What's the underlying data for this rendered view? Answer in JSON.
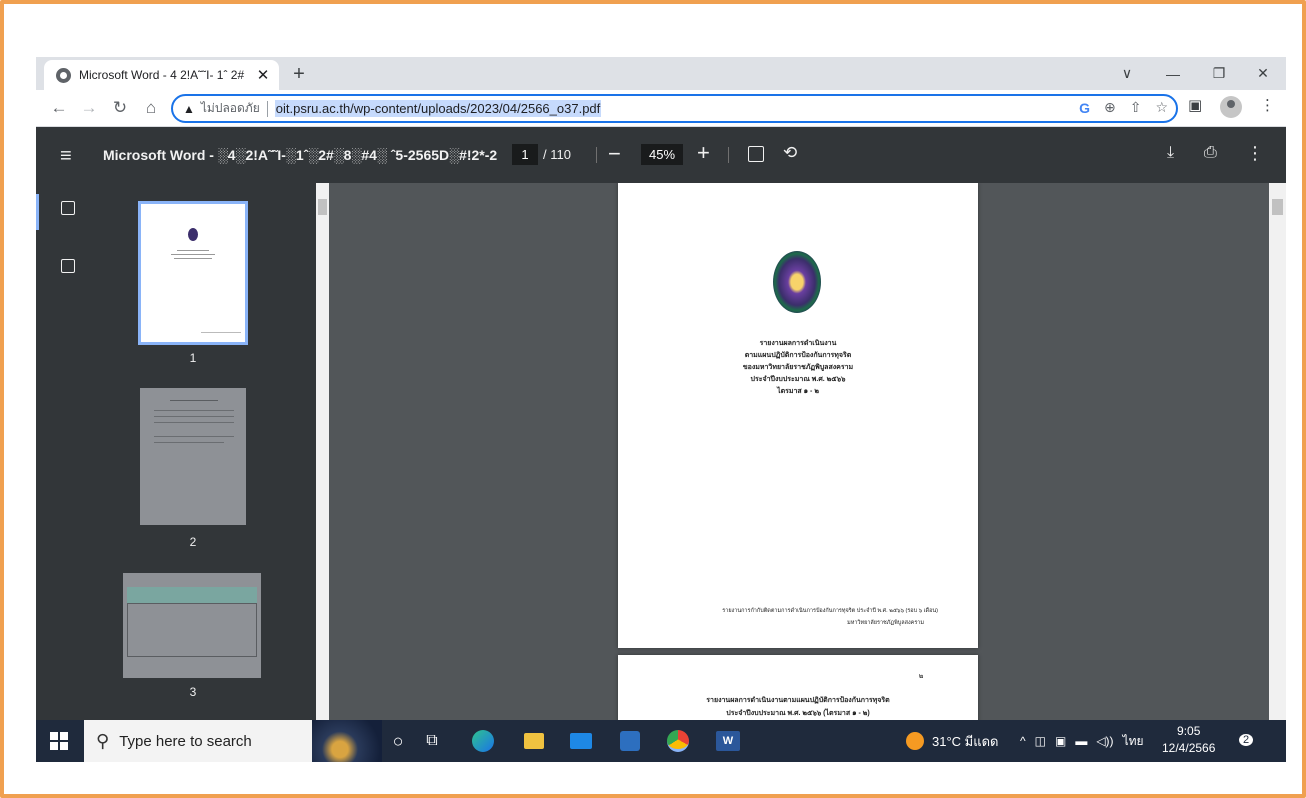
{
  "browser": {
    "tab_title": "Microsoft Word - 4 2!A˜˜I- 1ˆ 2#",
    "tab_close": "✕",
    "new_tab": "+",
    "not_secure_label": "ไม่ปลอดภัย",
    "url": "oit.psru.ac.th/wp-content/uploads/2023/04/2566_o37.pdf",
    "google_icon": "G"
  },
  "pdf": {
    "title": "Microsoft Word - ░4░2!A˜˜I-░1ˆ░2#░8░#4░ ˆ5-2565D░#!2*-2",
    "current_page": "1",
    "total_pages": "/ 110",
    "zoom": "45%",
    "thumbnails": [
      {
        "label": "1"
      },
      {
        "label": "2"
      },
      {
        "label": "3"
      }
    ],
    "page1": {
      "line1": "รายงานผลการดำเนินงาน",
      "line2": "ตามแผนปฏิบัติการป้องกันการทุจริต",
      "line3": "ของมหาวิทยาลัยราชภัฏพิบูลสงคราม",
      "line4": "ประจำปีงบประมาณ พ.ศ. ๒๕๖๖",
      "line5": "ไตรมาส ๑ - ๒",
      "footer1": "รายงานการกำกับติดตามการดำเนินการป้องกันการทุจริต ประจำปี พ.ศ. ๒๕๖๖ (รอบ ๖ เดือน)",
      "footer2": "มหาวิทยาลัยราชภัฏพิบูลสงคราม"
    },
    "page2": {
      "page_number": "๒",
      "line1": "รายงานผลการดำเนินงานตามแผนปฏิบัติการป้องกันการทุจริต",
      "line2": "ประจำปีงบประมาณ พ.ศ. ๒๕๖๖ (ไตรมาส ๑ - ๒)"
    }
  },
  "taskbar": {
    "search_placeholder": "Type here to search",
    "weather": "31°C มีแดด",
    "language": "ไทย",
    "time": "9:05",
    "date": "12/4/2566",
    "notification_count": "2",
    "word_icon_label": "W"
  },
  "colors": {
    "frame_border": "#f0a050",
    "pdf_toolbar": "#323639",
    "pdf_canvas": "#525659",
    "omnibox_focus": "#1a73e8",
    "taskbar": "#1f2a3c"
  },
  "icons": {
    "chevron-down": "∨",
    "minimize": "—",
    "restore": "❐",
    "close": "✕",
    "back": "←",
    "forward": "→",
    "reload": "↻",
    "home": "⌂",
    "warning": "▲",
    "zoom": "⊕",
    "share": "⇧",
    "star": "☆",
    "sidepanel": "▣",
    "menu": "⋮",
    "hamburger": "≡",
    "minus": "−",
    "plus": "+",
    "rotate": "⟲",
    "download": "⤓",
    "print": "⎙"
  }
}
